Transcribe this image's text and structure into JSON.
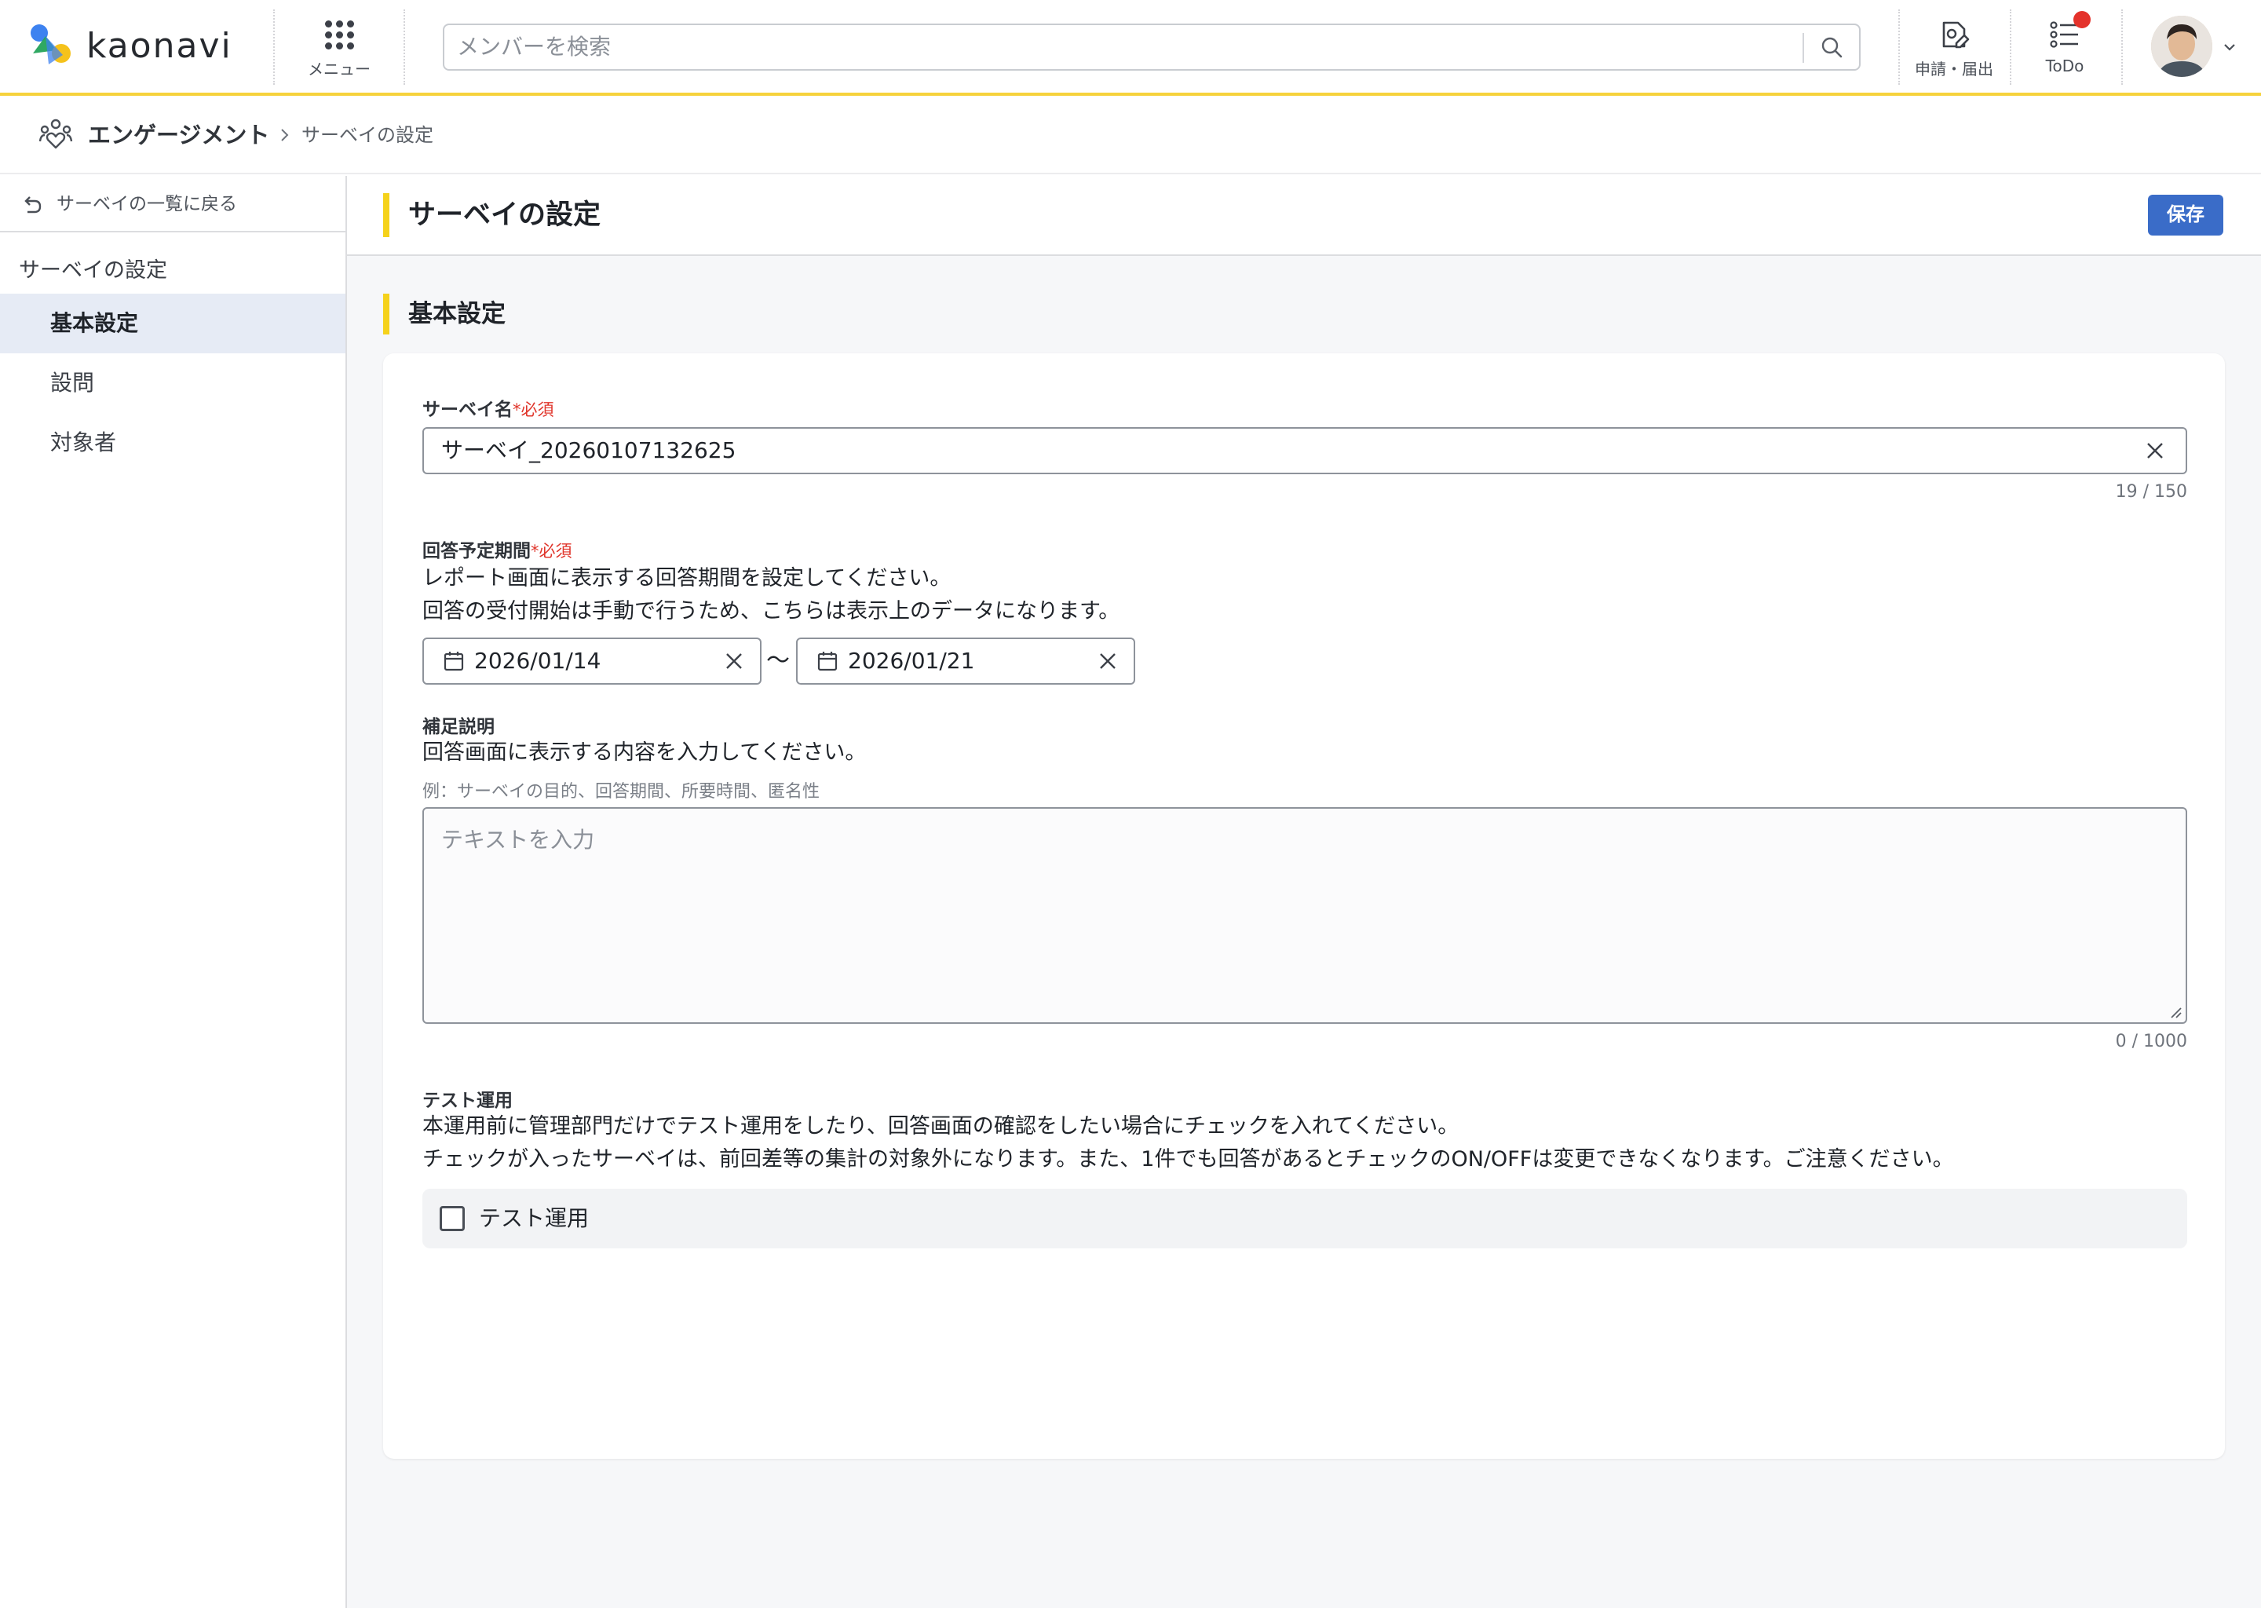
{
  "colors": {
    "accent_yellow": "#f5d21b",
    "primary_blue": "#3a6cc8",
    "required_red": "#e0352b",
    "notification_red": "#e4322b",
    "active_nav_bg": "#e6ebf5"
  },
  "header": {
    "logo_text": "kaonavi",
    "menu_label": "メニュー",
    "search_placeholder": "メンバーを検索",
    "requests_label": "申請・届出",
    "todo_label": "ToDo"
  },
  "breadcrumb": {
    "section": "エンゲージメント",
    "current": "サーベイの設定"
  },
  "sidebar": {
    "back_label": "サーベイの一覧に戻る",
    "heading": "サーベイの設定",
    "items": [
      {
        "label": "基本設定",
        "active": true
      },
      {
        "label": "設問",
        "active": false
      },
      {
        "label": "対象者",
        "active": false
      }
    ]
  },
  "main": {
    "title": "サーベイの設定",
    "save_label": "保存",
    "section_title": "基本設定"
  },
  "form": {
    "survey_name": {
      "label": "サーベイ名",
      "required": "*必須",
      "value": "サーベイ_20260107132625",
      "counter": "19 / 150"
    },
    "period": {
      "label": "回答予定期間",
      "required": "*必須",
      "desc1": "レポート画面に表示する回答期間を設定してください。",
      "desc2": "回答の受付開始は手動で行うため、こちらは表示上のデータになります。",
      "start": "2026/01/14",
      "separator": "〜",
      "end": "2026/01/21"
    },
    "note": {
      "label": "補足説明",
      "desc": "回答画面に表示する内容を入力してください。",
      "hint": "例：サーベイの目的、回答期間、所要時間、匿名性",
      "placeholder": "テキストを入力",
      "counter": "0 / 1000"
    },
    "test": {
      "label": "テスト運用",
      "desc1": "本運用前に管理部門だけでテスト運用をしたり、回答画面の確認をしたい場合にチェックを入れてください。",
      "desc2": "チェックが入ったサーベイは、前回差等の集計の対象外になります。また、1件でも回答があるとチェックのON/OFFは変更できなくなります。ご注意ください。",
      "checkbox_label": "テスト運用",
      "checked": false
    }
  },
  "icons": [
    "logo-mark-icon",
    "menu-grid-icon",
    "search-icon",
    "request-icon",
    "todo-list-icon",
    "chevron-down-icon",
    "engagement-icon",
    "chevron-right-icon",
    "undo-arrow-icon",
    "clear-icon",
    "calendar-icon",
    "resize-grip-icon"
  ]
}
